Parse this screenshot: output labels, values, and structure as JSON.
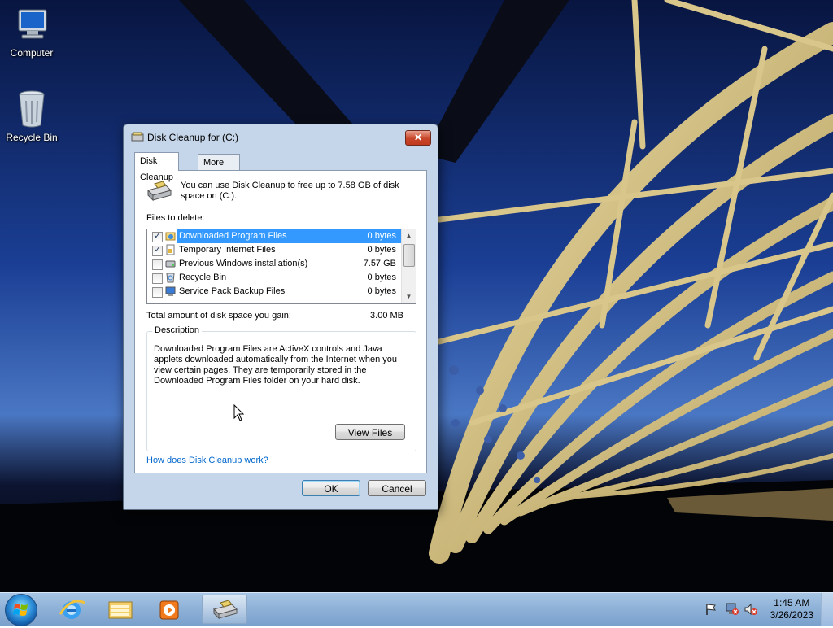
{
  "desktop": {
    "icons": [
      {
        "label": "Computer"
      },
      {
        "label": "Recycle Bin"
      }
    ]
  },
  "dialog": {
    "title": "Disk Cleanup for  (C:)",
    "close_glyph": "✕",
    "tabs": [
      {
        "label": "Disk Cleanup",
        "active": true
      },
      {
        "label": "More Options",
        "active": false
      }
    ],
    "intro_text": "You can use Disk Cleanup to free up to 7.58 GB of disk space on  (C:).",
    "files_label": "Files to delete:",
    "files": [
      {
        "name": "Downloaded Program Files",
        "size": "0 bytes",
        "checked": true,
        "selected": true,
        "icon": "folder-globe-icon"
      },
      {
        "name": "Temporary Internet Files",
        "size": "0 bytes",
        "checked": true,
        "selected": false,
        "icon": "lock-file-icon"
      },
      {
        "name": "Previous Windows installation(s)",
        "size": "7.57 GB",
        "checked": false,
        "selected": false,
        "icon": "disk-icon"
      },
      {
        "name": "Recycle Bin",
        "size": "0 bytes",
        "checked": false,
        "selected": false,
        "icon": "recycle-bin-icon"
      },
      {
        "name": "Service Pack Backup Files",
        "size": "0 bytes",
        "checked": false,
        "selected": false,
        "icon": "computer-icon"
      }
    ],
    "total_label": "Total amount of disk space you gain:",
    "total_value": "3.00 MB",
    "description_label": "Description",
    "description_text": "Downloaded Program Files are ActiveX controls and Java applets downloaded automatically from the Internet when you view certain pages. They are temporarily stored in the Downloaded Program Files folder on your hard disk.",
    "view_files_label": "View Files",
    "help_link": "How does Disk Cleanup work?",
    "ok_label": "OK",
    "cancel_label": "Cancel"
  },
  "taskbar": {
    "pinned": [
      {
        "icon": "internet-explorer-icon"
      },
      {
        "icon": "file-explorer-icon"
      },
      {
        "icon": "media-player-icon"
      },
      {
        "icon": "disk-cleanup-icon",
        "active": true
      }
    ],
    "tray": [
      {
        "icon": "action-center-flag-icon"
      },
      {
        "icon": "network-icon"
      },
      {
        "icon": "volume-muted-icon"
      }
    ],
    "clock_time": "1:45 AM",
    "clock_date": "3/26/2023"
  }
}
